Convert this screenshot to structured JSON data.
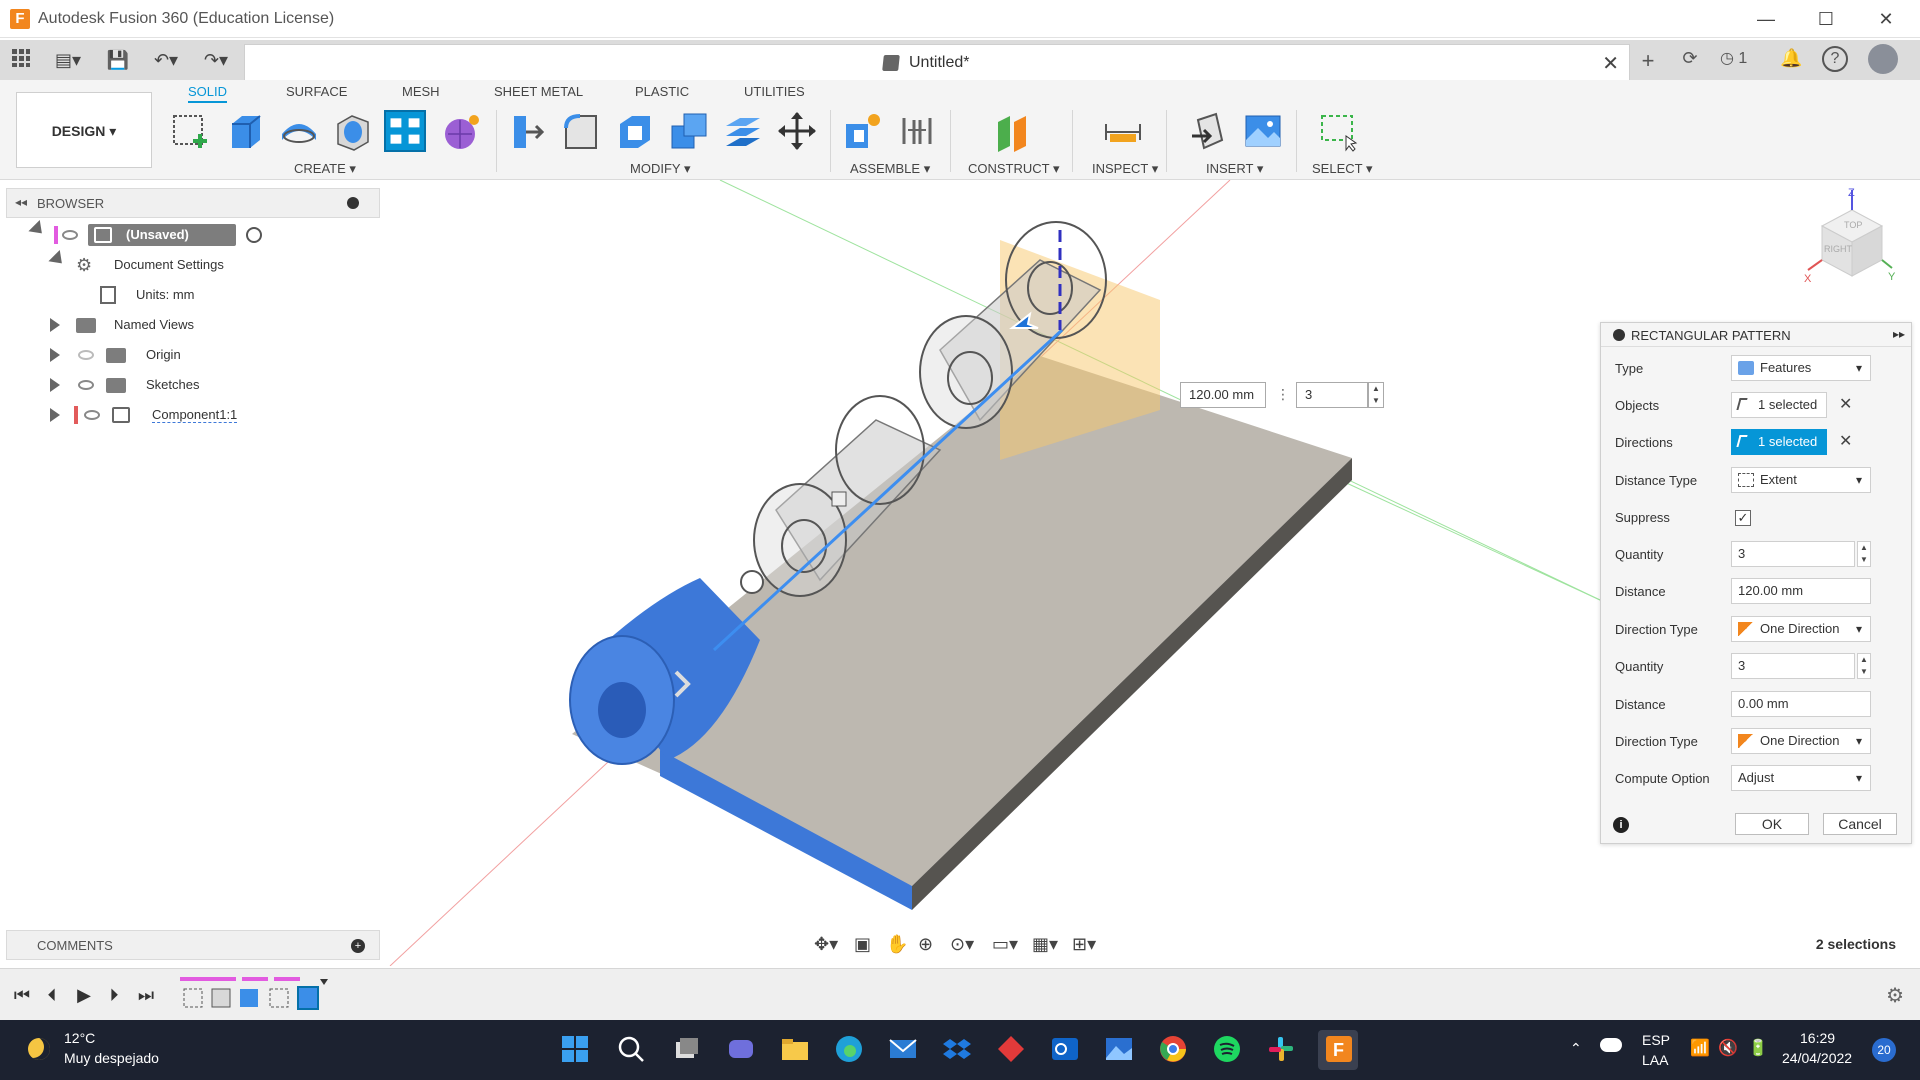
{
  "window": {
    "title": "Autodesk Fusion 360 (Education License)"
  },
  "document": {
    "title": "Untitled*"
  },
  "account": {
    "job_count": "1"
  },
  "toolbar": {
    "workspace": "DESIGN",
    "tabs": [
      "SOLID",
      "SURFACE",
      "MESH",
      "SHEET METAL",
      "PLASTIC",
      "UTILITIES"
    ],
    "groups": [
      "CREATE",
      "MODIFY",
      "ASSEMBLE",
      "CONSTRUCT",
      "INSPECT",
      "INSERT",
      "SELECT"
    ]
  },
  "browser": {
    "title": "BROWSER",
    "root": "(Unsaved)",
    "items": [
      "Document Settings",
      "Units: mm",
      "Named Views",
      "Origin",
      "Sketches",
      "Component1:1"
    ]
  },
  "comments": {
    "title": "COMMENTS"
  },
  "status": {
    "selections": "2 selections"
  },
  "canvas_inputs": {
    "distance": "120.00 mm",
    "quantity": "3"
  },
  "view_cube": {
    "faces": [
      "TOP",
      "RIGHT"
    ],
    "axes": [
      "Z",
      "X",
      "Y"
    ]
  },
  "dialog": {
    "title": "RECTANGULAR PATTERN",
    "rows": [
      {
        "label": "Type",
        "value": "Features"
      },
      {
        "label": "Objects",
        "value": "1 selected"
      },
      {
        "label": "Directions",
        "value": "1 selected"
      },
      {
        "label": "Distance Type",
        "value": "Extent"
      },
      {
        "label": "Suppress",
        "value": "✓"
      },
      {
        "label": "Quantity",
        "value": "3"
      },
      {
        "label": "Distance",
        "value": "120.00 mm"
      },
      {
        "label": "Direction Type",
        "value": "One Direction"
      },
      {
        "label": "Quantity",
        "value": "3"
      },
      {
        "label": "Distance",
        "value": "0.00 mm"
      },
      {
        "label": "Direction Type",
        "value": "One Direction"
      },
      {
        "label": "Compute Option",
        "value": "Adjust"
      }
    ],
    "ok": "OK",
    "cancel": "Cancel"
  },
  "taskbar": {
    "weather_temp": "12°C",
    "weather_desc": "Muy despejado",
    "lang": "ESP",
    "region": "LAA",
    "time": "16:29",
    "date": "24/04/2022",
    "notifications": "20"
  },
  "colors": {
    "accent": "#0696d7",
    "part": "#bdb8b0",
    "selected": "#3d78d8",
    "preview": "#f7c76c"
  }
}
